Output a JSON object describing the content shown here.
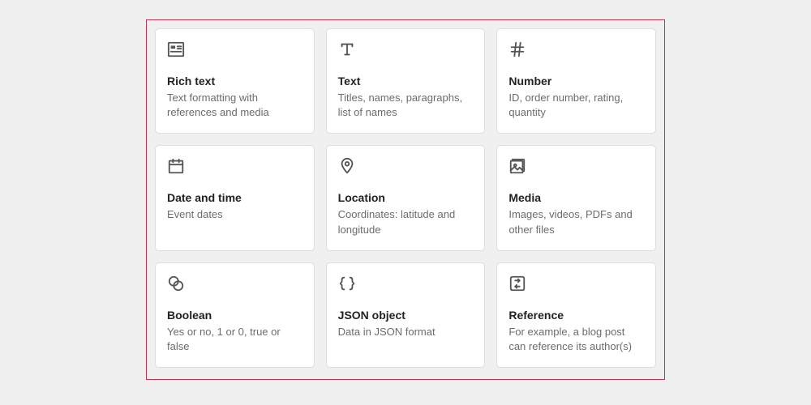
{
  "fields": [
    {
      "id": "richtext",
      "title": "Rich text",
      "desc": "Text formatting with references and media"
    },
    {
      "id": "text",
      "title": "Text",
      "desc": "Titles, names, paragraphs, list of names"
    },
    {
      "id": "number",
      "title": "Number",
      "desc": "ID, order number, rating, quantity"
    },
    {
      "id": "datetime",
      "title": "Date and time",
      "desc": "Event dates"
    },
    {
      "id": "location",
      "title": "Location",
      "desc": "Coordinates: latitude and longitude"
    },
    {
      "id": "media",
      "title": "Media",
      "desc": "Images, videos, PDFs and other files"
    },
    {
      "id": "boolean",
      "title": "Boolean",
      "desc": "Yes or no, 1 or 0, true or false"
    },
    {
      "id": "json",
      "title": "JSON object",
      "desc": "Data in JSON format"
    },
    {
      "id": "reference",
      "title": "Reference",
      "desc": "For example, a blog post can reference its author(s)"
    }
  ]
}
